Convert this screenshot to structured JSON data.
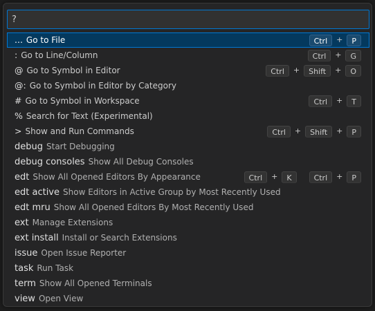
{
  "search": {
    "value": "?"
  },
  "items": [
    {
      "prefix": "...",
      "word": false,
      "label": "Go to File",
      "selected": true,
      "keys": [
        [
          "Ctrl",
          "P"
        ]
      ]
    },
    {
      "prefix": ":",
      "word": false,
      "label": "Go to Line/Column",
      "selected": false,
      "keys": [
        [
          "Ctrl",
          "G"
        ]
      ]
    },
    {
      "prefix": "@",
      "word": false,
      "label": "Go to Symbol in Editor",
      "selected": false,
      "keys": [
        [
          "Ctrl",
          "Shift",
          "O"
        ]
      ]
    },
    {
      "prefix": "@:",
      "word": false,
      "label": "Go to Symbol in Editor by Category",
      "selected": false,
      "keys": []
    },
    {
      "prefix": "#",
      "word": false,
      "label": "Go to Symbol in Workspace",
      "selected": false,
      "keys": [
        [
          "Ctrl",
          "T"
        ]
      ]
    },
    {
      "prefix": "%",
      "word": false,
      "label": "Search for Text (Experimental)",
      "selected": false,
      "keys": []
    },
    {
      "prefix": ">",
      "word": false,
      "label": "Show and Run Commands",
      "selected": false,
      "keys": [
        [
          "Ctrl",
          "Shift",
          "P"
        ]
      ]
    },
    {
      "prefix": "debug",
      "word": true,
      "label": "Start Debugging",
      "selected": false,
      "keys": []
    },
    {
      "prefix": "debug consoles",
      "word": true,
      "label": "Show All Debug Consoles",
      "selected": false,
      "keys": []
    },
    {
      "prefix": "edt",
      "word": true,
      "label": "Show All Opened Editors By Appearance",
      "selected": false,
      "keys": [
        [
          "Ctrl",
          "K"
        ],
        [
          "Ctrl",
          "P"
        ]
      ]
    },
    {
      "prefix": "edt active",
      "word": true,
      "label": "Show Editors in Active Group by Most Recently Used",
      "selected": false,
      "keys": []
    },
    {
      "prefix": "edt mru",
      "word": true,
      "label": "Show All Opened Editors By Most Recently Used",
      "selected": false,
      "keys": []
    },
    {
      "prefix": "ext",
      "word": true,
      "label": "Manage Extensions",
      "selected": false,
      "keys": []
    },
    {
      "prefix": "ext install",
      "word": true,
      "label": "Install or Search Extensions",
      "selected": false,
      "keys": []
    },
    {
      "prefix": "issue",
      "word": true,
      "label": "Open Issue Reporter",
      "selected": false,
      "keys": []
    },
    {
      "prefix": "task",
      "word": true,
      "label": "Run Task",
      "selected": false,
      "keys": []
    },
    {
      "prefix": "term",
      "word": true,
      "label": "Show All Opened Terminals",
      "selected": false,
      "keys": []
    },
    {
      "prefix": "view",
      "word": true,
      "label": "Open View",
      "selected": false,
      "keys": []
    }
  ],
  "keybinding_separator": "+",
  "colors": {
    "accent": "#0078d4",
    "selected_background": "#04395e",
    "panel_background": "#252526"
  }
}
